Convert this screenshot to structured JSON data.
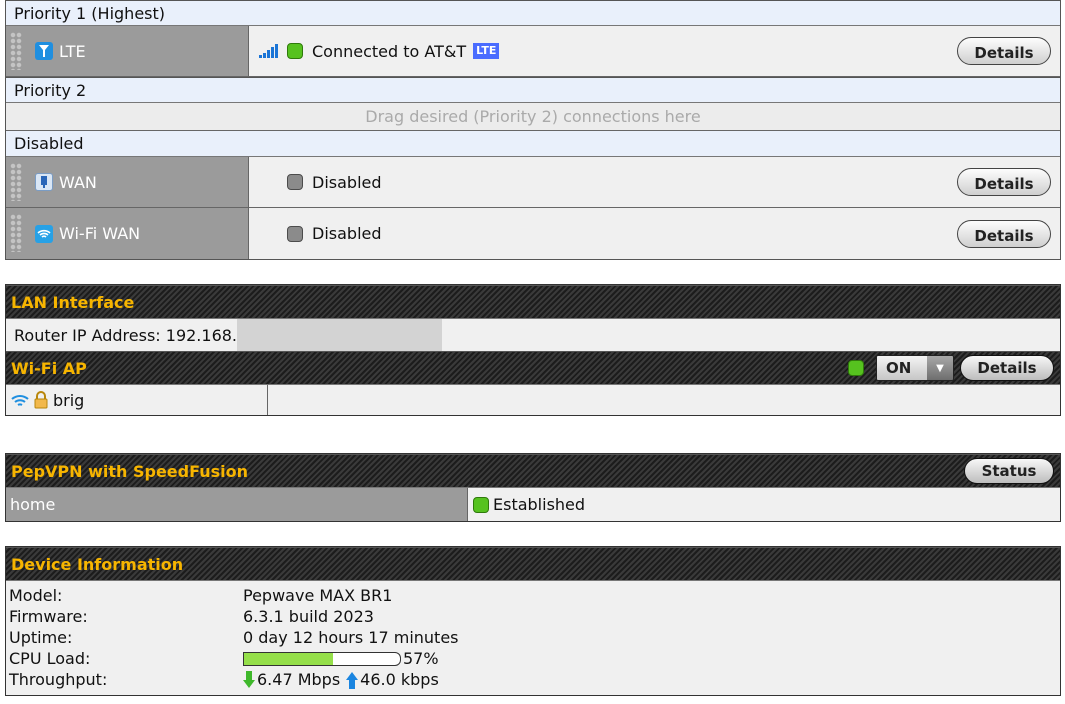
{
  "wan": {
    "groups": [
      {
        "header": "Priority 1 (Highest)",
        "rows": [
          {
            "name": "LTE",
            "icon": "cellular-icon",
            "status": "Connected to AT&T",
            "badge": "LTE",
            "button": "Details"
          }
        ]
      },
      {
        "header": "Priority 2",
        "placeholder": "Drag desired (Priority 2) connections here"
      },
      {
        "header": "Disabled",
        "rows": [
          {
            "name": "WAN",
            "icon": "ethernet-icon",
            "status": "Disabled",
            "button": "Details"
          },
          {
            "name": "Wi-Fi WAN",
            "icon": "wifi-icon",
            "status": "Disabled",
            "button": "Details"
          }
        ]
      }
    ]
  },
  "lan": {
    "title": "LAN Interface",
    "router_ip_label": "Router IP Address: 192.168."
  },
  "wifi_ap": {
    "title": "Wi-Fi AP",
    "toggle_value": "ON",
    "button": "Details",
    "ssid": "brig"
  },
  "pepvpn": {
    "title": "PepVPN with SpeedFusion",
    "button": "Status",
    "profile": "home",
    "status": "Established"
  },
  "device": {
    "title": "Device Information",
    "model_label": "Model:",
    "model": "Pepwave MAX BR1",
    "firmware_label": "Firmware:",
    "firmware": "6.3.1 build 2023",
    "uptime_label": "Uptime:",
    "uptime": "0 day 12 hours 17 minutes",
    "cpu_label": "CPU Load:",
    "cpu_percent": 57,
    "cpu_text": "57%",
    "throughput_label": "Throughput:",
    "download": "6.47 Mbps",
    "upload": "46.0 kbps"
  },
  "colors": {
    "accent_yellow": "#f7b500",
    "status_green": "#56c21f",
    "status_grey": "#8b8b8b",
    "lte_badge": "#4a6cff",
    "download_arrow": "#3fb82b",
    "upload_arrow": "#1a85e0"
  }
}
